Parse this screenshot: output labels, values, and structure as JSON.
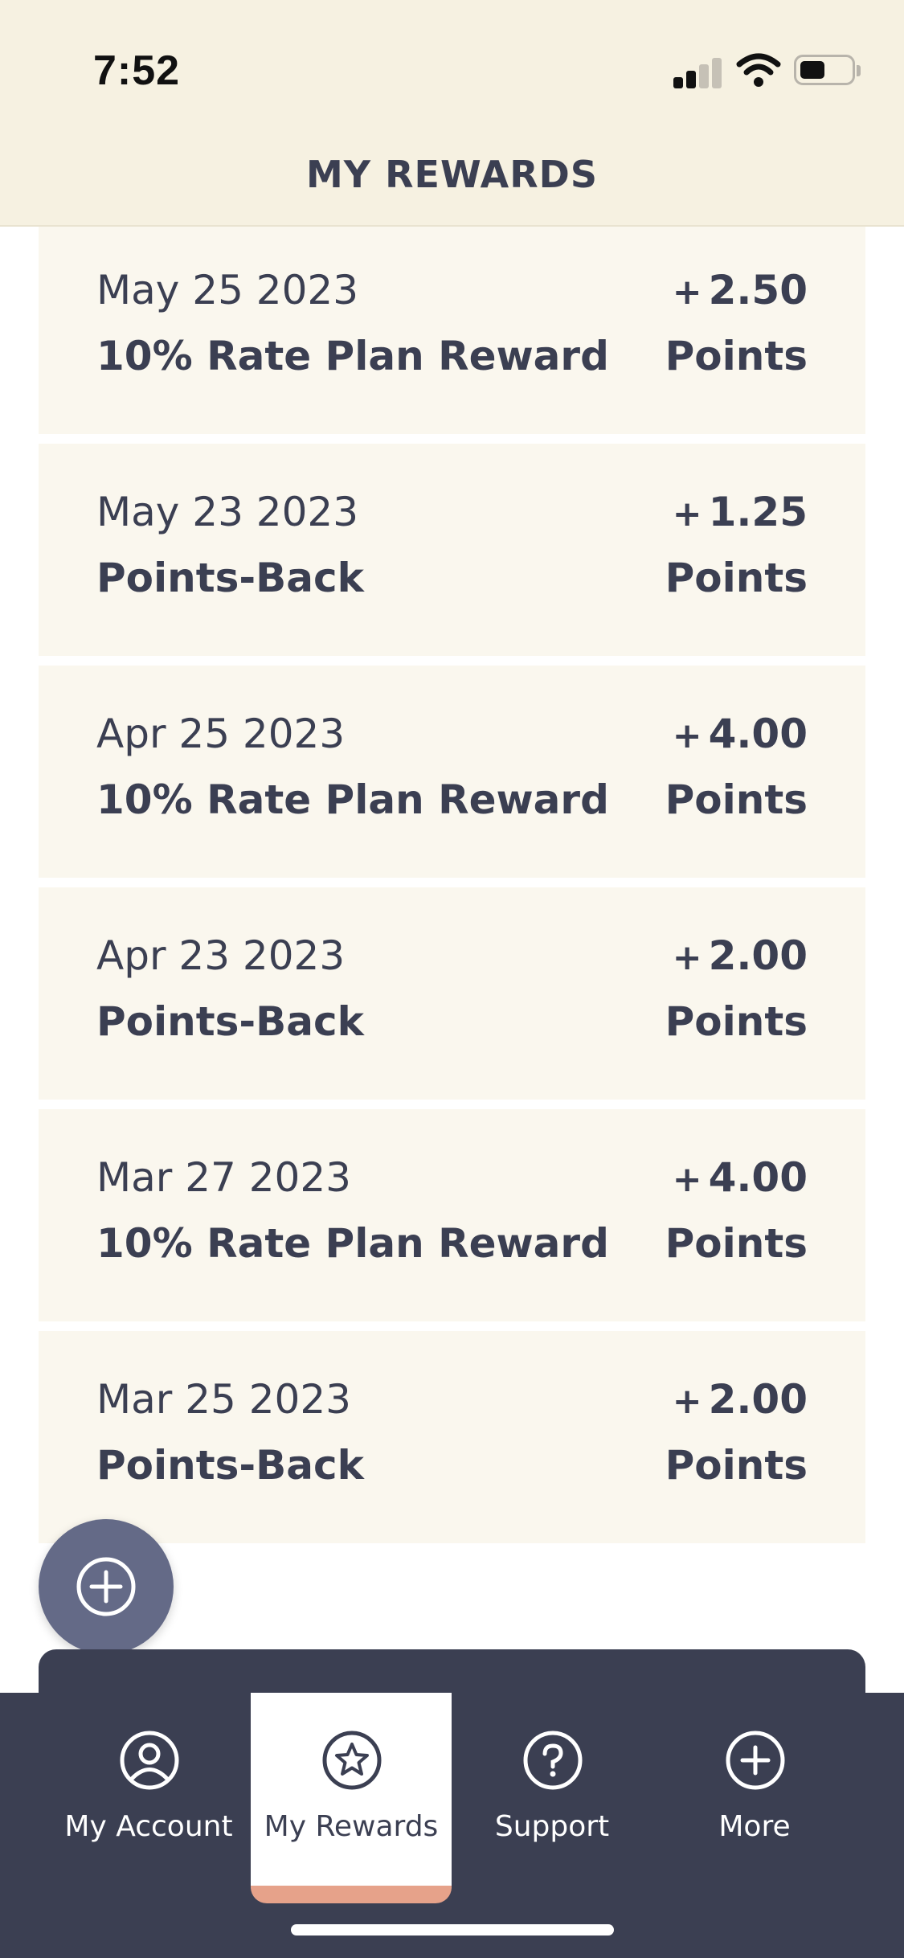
{
  "status_bar": {
    "time": "7:52"
  },
  "header": {
    "title": "MY REWARDS"
  },
  "rewards": [
    {
      "date": "May 25 2023",
      "name": "10% Rate Plan Reward",
      "amount": "2.50",
      "sign": "+",
      "unit": "Points"
    },
    {
      "date": "May 23 2023",
      "name": "Points-Back",
      "amount": "1.25",
      "sign": "+",
      "unit": "Points"
    },
    {
      "date": "Apr 25 2023",
      "name": "10% Rate Plan Reward",
      "amount": "4.00",
      "sign": "+",
      "unit": "Points"
    },
    {
      "date": "Apr 23 2023",
      "name": "Points-Back",
      "amount": "2.00",
      "sign": "+",
      "unit": "Points"
    },
    {
      "date": "Mar 27 2023",
      "name": "10% Rate Plan Reward",
      "amount": "4.00",
      "sign": "+",
      "unit": "Points"
    },
    {
      "date": "Mar 25 2023",
      "name": "Points-Back",
      "amount": "2.00",
      "sign": "+",
      "unit": "Points"
    }
  ],
  "fab": {
    "icon": "plus-circle-icon"
  },
  "tabs": [
    {
      "label": "My Account",
      "icon": "user-circle-icon",
      "active": false
    },
    {
      "label": "My Rewards",
      "icon": "star-circle-icon",
      "active": true
    },
    {
      "label": "Support",
      "icon": "question-circle-icon",
      "active": false
    },
    {
      "label": "More",
      "icon": "plus-circle-icon",
      "active": false
    }
  ],
  "colors": {
    "header_bg": "#f6f1e1",
    "card_bg": "#faf7ee",
    "text_dark": "#3b3f52",
    "tabbar_bg": "#3b3f52",
    "fab_bg": "#646a87",
    "active_tab_accent": "#e6a28a"
  }
}
